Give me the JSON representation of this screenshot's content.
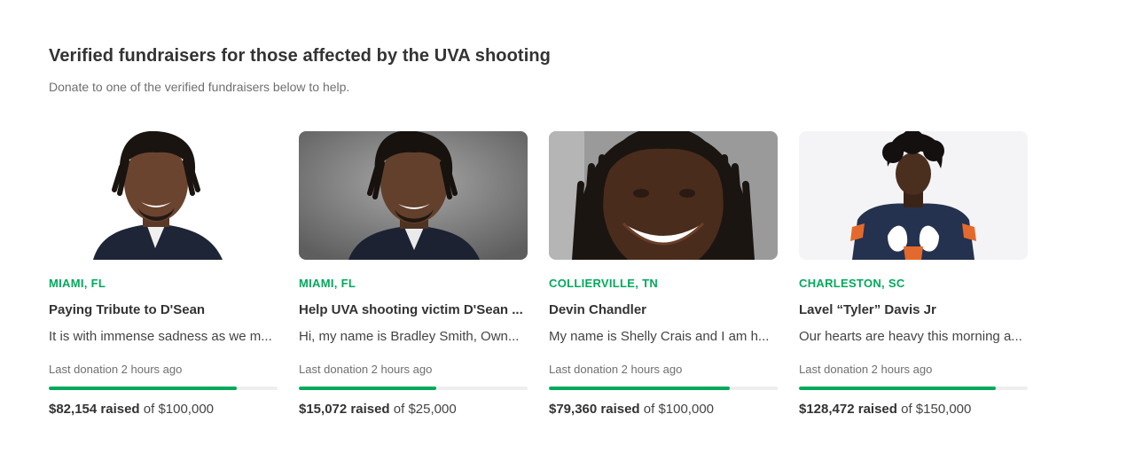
{
  "section": {
    "title": "Verified fundraisers for those affected by the UVA shooting",
    "subtitle": "Donate to one of the verified fundraisers below to help."
  },
  "colors": {
    "accent": "#02a95c",
    "track": "#eeeeee",
    "text": "#333333",
    "muted": "#6f6f6f"
  },
  "cards": [
    {
      "location": "MIAMI, FL",
      "title": "Paying Tribute to D'Sean",
      "description": "It is with immense sadness as we m...",
      "last_donation": "Last donation 2 hours ago",
      "raised": "$82,154 raised",
      "goal": "of $100,000",
      "progress": 0.82,
      "photo": "portrait-photo"
    },
    {
      "location": "MIAMI, FL",
      "title": "Help UVA shooting victim D'Sean ...",
      "description": "Hi, my name is Bradley Smith, Own...",
      "last_donation": "Last donation 2 hours ago",
      "raised": "$15,072 raised",
      "goal": "of $25,000",
      "progress": 0.6,
      "photo": "portrait-photo"
    },
    {
      "location": "COLLIERVILLE, TN",
      "title": "Devin Chandler",
      "description": "My name is Shelly Crais and I am h...",
      "last_donation": "Last donation 2 hours ago",
      "raised": "$79,360 raised",
      "goal": "of $100,000",
      "progress": 0.79,
      "photo": "portrait-photo"
    },
    {
      "location": "CHARLESTON, SC",
      "title": "Lavel “Tyler” Davis Jr",
      "description": "Our hearts are heavy this morning a...",
      "last_donation": "Last donation 2 hours ago",
      "raised": "$128,472 raised",
      "goal": "of $150,000",
      "progress": 0.86,
      "photo": "portrait-photo"
    }
  ]
}
